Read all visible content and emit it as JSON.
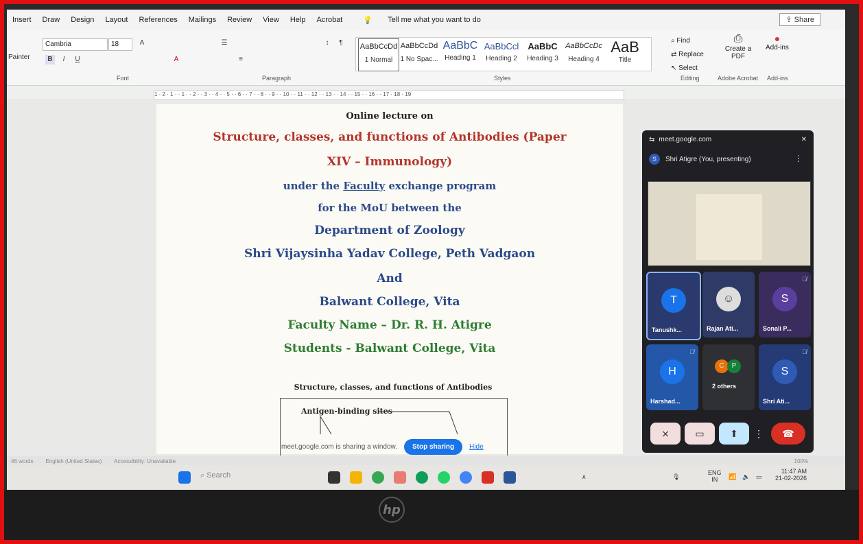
{
  "word": {
    "tabs": [
      "Insert",
      "Draw",
      "Design",
      "Layout",
      "References",
      "Mailings",
      "Review",
      "View",
      "Help",
      "Acrobat"
    ],
    "tell_me": "Tell me what you want to do",
    "share": "Share",
    "clipboard_label": "Painter",
    "font_name": "Cambria",
    "font_size": "18",
    "group_font": "Font",
    "group_paragraph": "Paragraph",
    "group_styles": "Styles",
    "group_editing": "Editing",
    "group_adobe": "Adobe Acrobat",
    "group_addins": "Add-ins",
    "styles": [
      {
        "sample": "AaBbCcDd",
        "name": "1 Normal"
      },
      {
        "sample": "AaBbCcDd",
        "name": "1 No Spac..."
      },
      {
        "sample": "AaBbC",
        "name": "Heading 1"
      },
      {
        "sample": "AaBbCcl",
        "name": "Heading 2"
      },
      {
        "sample": "AaBbC",
        "name": "Heading 3"
      },
      {
        "sample": "AaBbCcDc",
        "name": "Heading 4"
      },
      {
        "sample": "AaB",
        "name": "Title"
      }
    ],
    "editing": {
      "find": "Find",
      "replace": "Replace",
      "select": "Select"
    },
    "create_pdf": "Create a PDF",
    "addins": "Add-ins",
    "ruler_marks": "1 · 2 · 1 · · 1 · · 2 · · 3 · · 4 · · 5 · · 6 · · 7 · · 8 · · 9 · · 10 · · 11 · · 12 · · 13 · · 14 · · 15 · · 16 · · 17 · 18 · 19"
  },
  "document": {
    "line1": "Online lecture on",
    "line2": "Structure, classes, and functions of Antibodies (Paper",
    "line3": "XIV – Immunology)",
    "line4_pre": "under the ",
    "line4_link": "Faculty",
    "line4_post": " exchange program",
    "line5": "for the MoU between the",
    "line6": "Department of Zoology",
    "line7": "Shri Vijaysinha Yadav College, Peth Vadgaon",
    "line8": "And",
    "line9": "Balwant College, Vita",
    "line10": "Faculty Name – Dr. R. H. Atigre",
    "line11": "Students - Balwant College, Vita",
    "diagram_title": "Structure, classes, and functions of Antibodies",
    "diagram_label": "Antigen-binding sites"
  },
  "share_bar": {
    "text": "meet.google.com is sharing a window.",
    "stop": "Stop sharing",
    "hide": "Hide"
  },
  "status_bar": {
    "words": "46 words",
    "language": "English (United States)",
    "accessibility": "Accessibility: Unavailable",
    "zoom": "100%"
  },
  "taskbar": {
    "search": "Search",
    "lang_top": "ENG",
    "lang_bottom": "IN",
    "time": "11:47 AM",
    "date": "21-02-2026"
  },
  "meet": {
    "url": "meet.google.com",
    "presenter_initial": "S",
    "presenter": "Shri Atigre (You, presenting)",
    "tiles": [
      {
        "initial": "T",
        "name": "Tanushk...",
        "color": "#1a73e8"
      },
      {
        "initial": "",
        "name": "Rajan Ati...",
        "color": "#ffffff"
      },
      {
        "initial": "S",
        "name": "Sonali P...",
        "color": "#5b3f9e"
      },
      {
        "initial": "H",
        "name": "Harshad...",
        "color": "#1a73e8"
      },
      {
        "initial": "",
        "name": "2 others",
        "color": "#3c4043"
      },
      {
        "initial": "S",
        "name": "Shri Ati...",
        "color": "#2f5bb5"
      }
    ],
    "others_initials": [
      "C",
      "P"
    ]
  },
  "colors": {
    "title_red": "#b3352b",
    "blue_text": "#2b4a8a",
    "green_text": "#2e7d32",
    "meet_bg": "#1f1f24",
    "end_call": "#d93025"
  }
}
